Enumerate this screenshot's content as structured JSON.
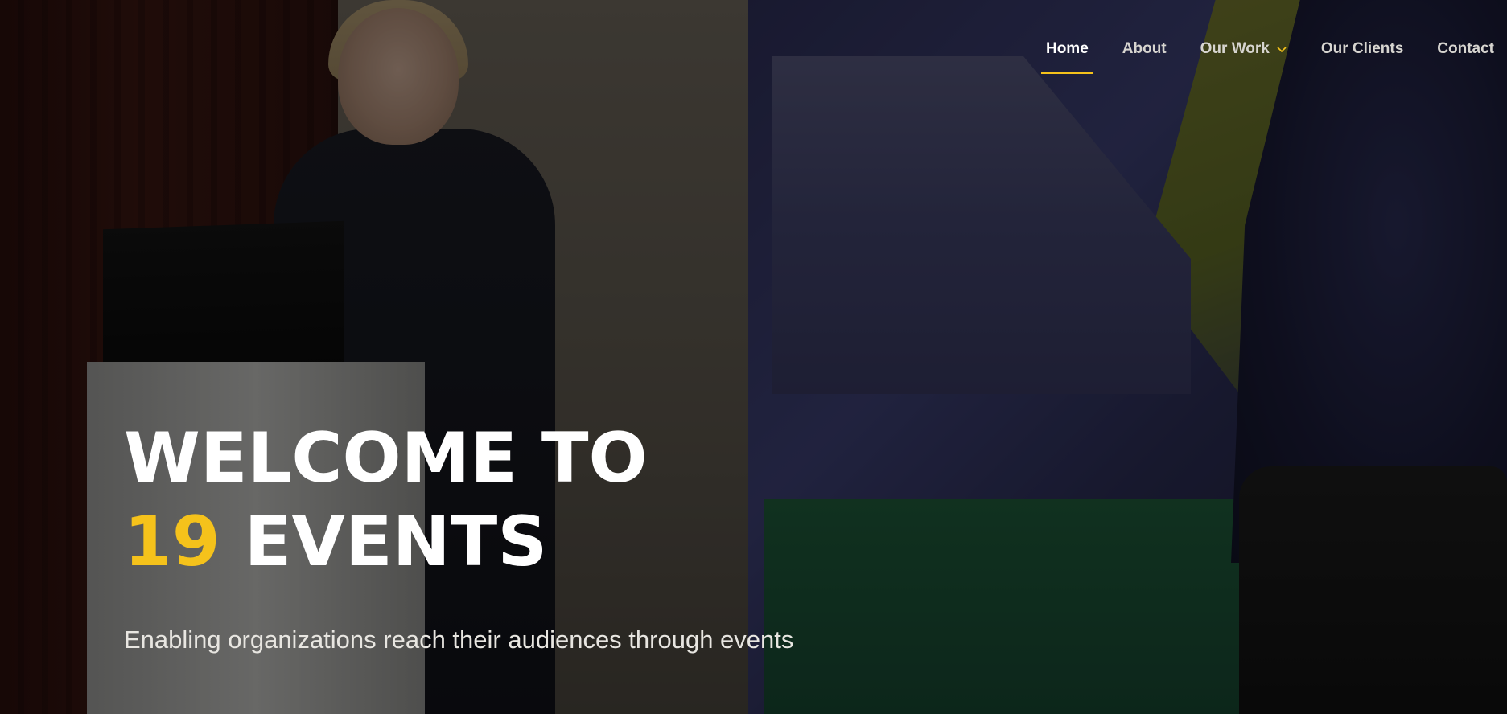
{
  "nav": {
    "items": [
      {
        "label": "Home",
        "active": true
      },
      {
        "label": "About"
      },
      {
        "label": "Our Work",
        "has_dropdown": true
      },
      {
        "label": "Our Clients"
      },
      {
        "label": "Contact"
      }
    ]
  },
  "hero": {
    "headline_line1": "WELCOME TO",
    "headline_accent": "19",
    "headline_line2_rest": "EVENTS",
    "tagline": "Enabling organizations reach their audiences through events"
  },
  "colors": {
    "accent": "#f5c21b",
    "text": "#ffffff",
    "nav_inactive": "#d7d5d0"
  }
}
